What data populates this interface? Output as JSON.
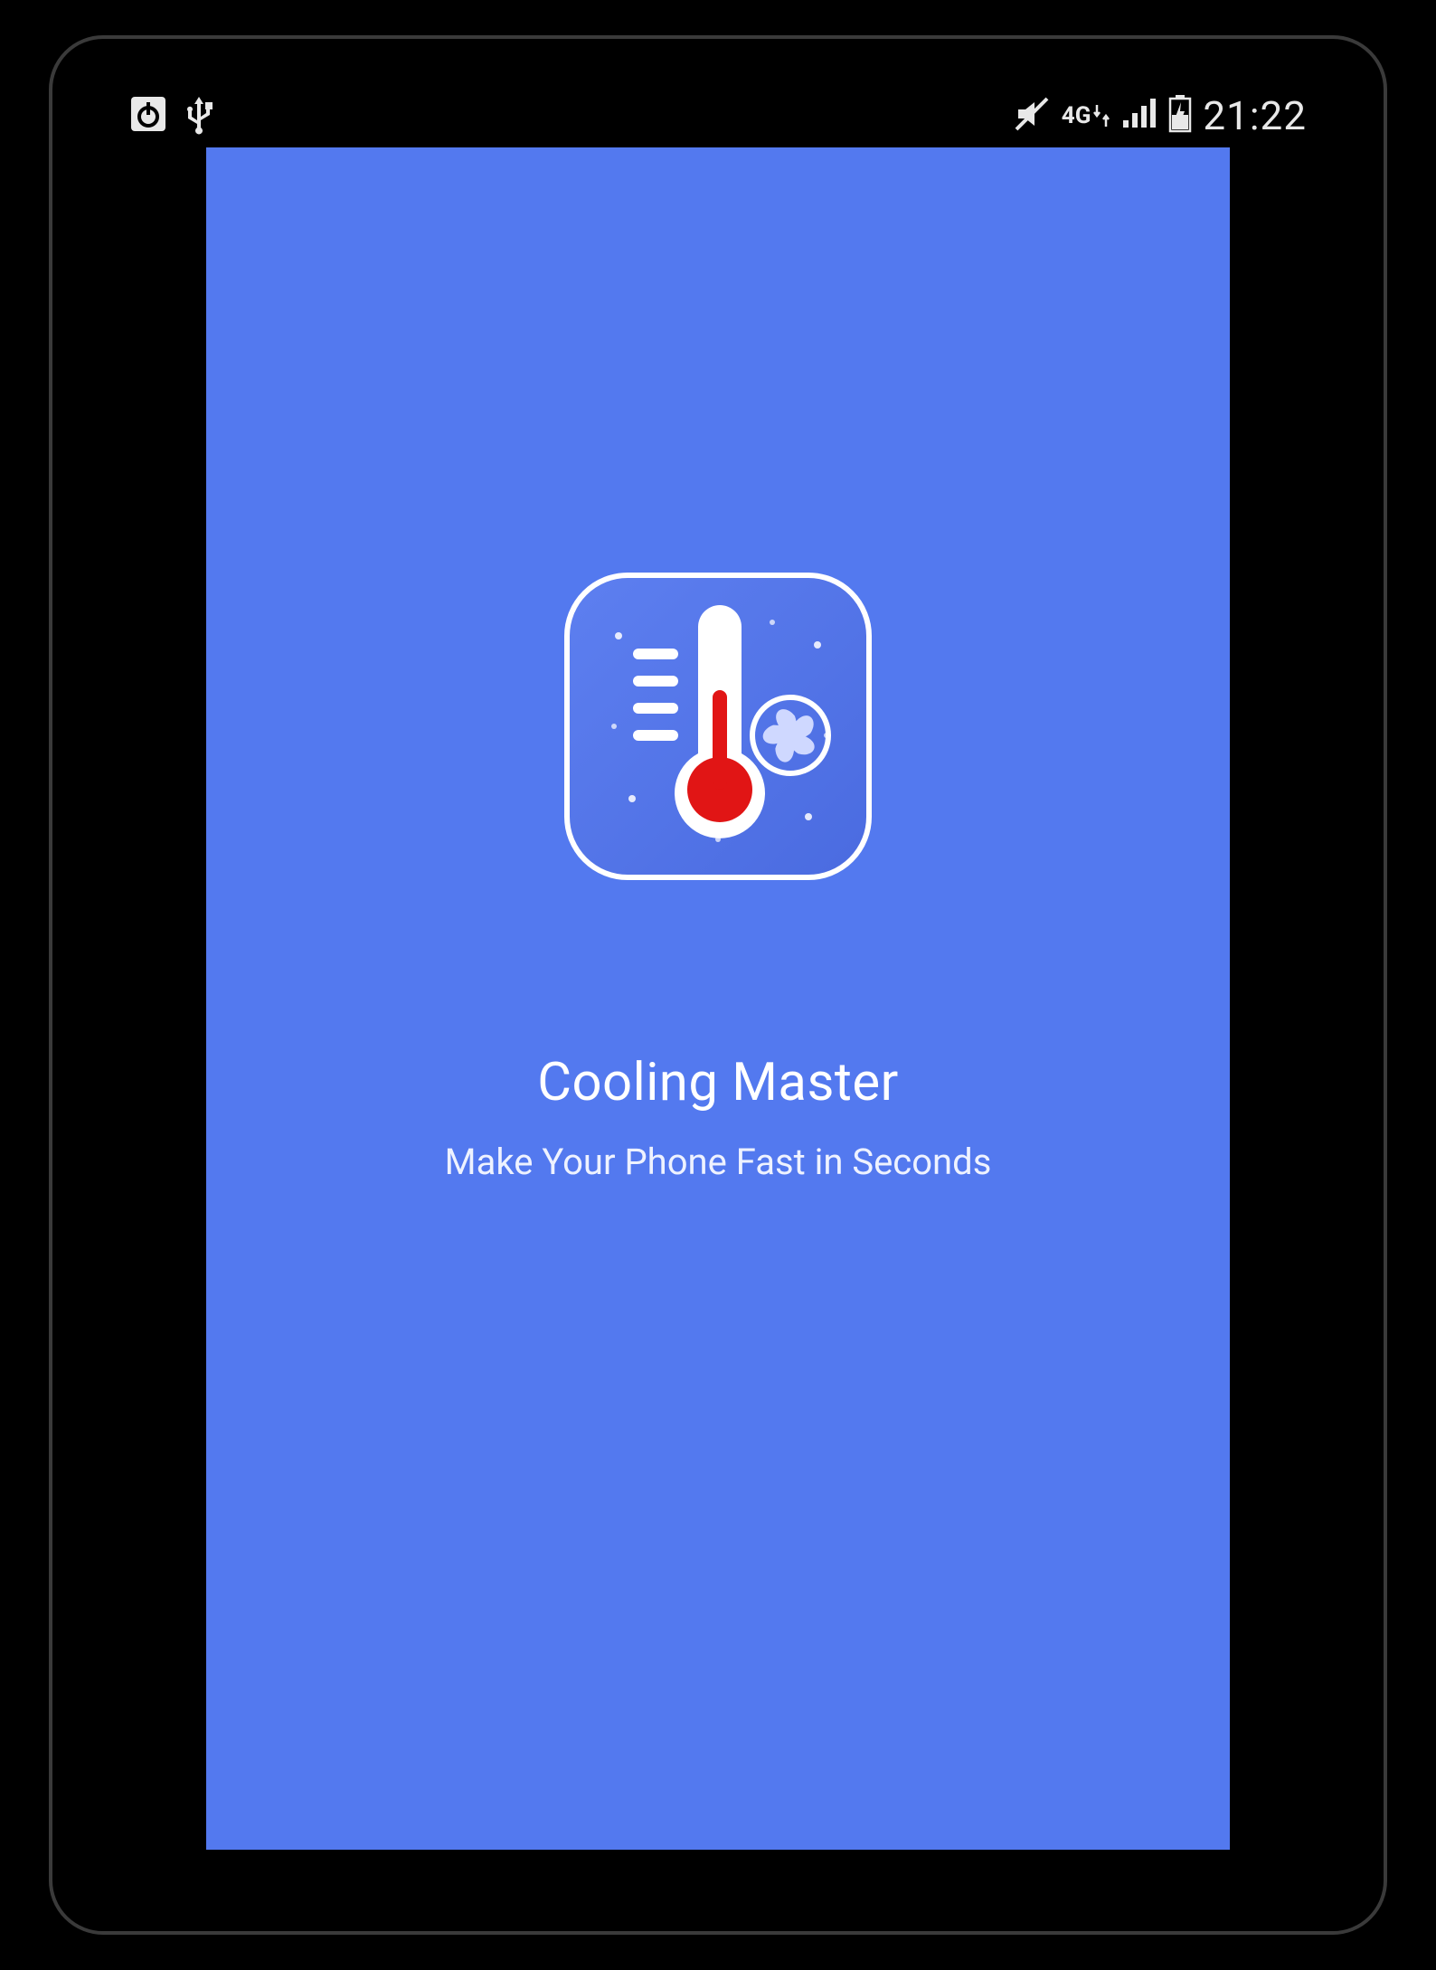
{
  "status_bar": {
    "time": "21:22",
    "network_label": "4G"
  },
  "splash": {
    "title": "Cooling Master",
    "subtitle": "Make Your Phone Fast in Seconds"
  }
}
